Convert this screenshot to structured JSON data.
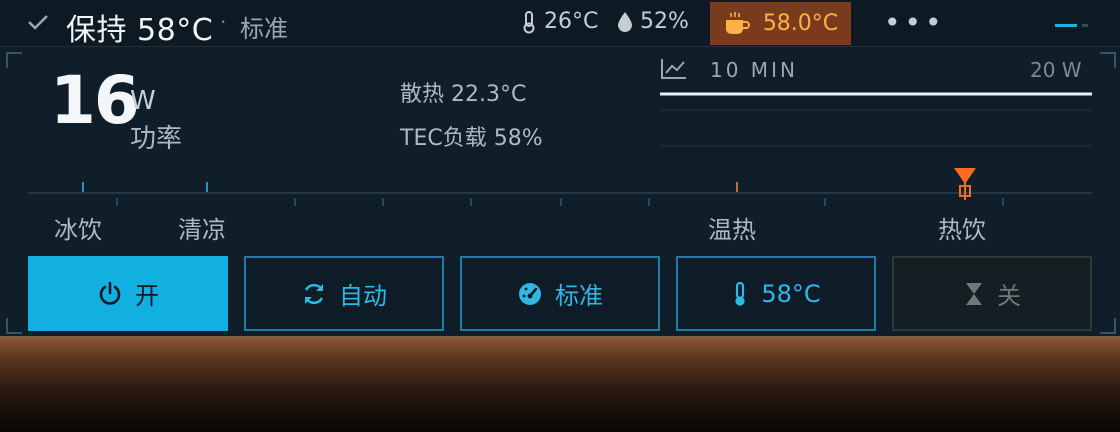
{
  "header": {
    "check_icon": "check-icon",
    "title": "保持 58°C",
    "separator": "·",
    "mode": "标准",
    "temperature": "26°C",
    "temperature_icon": "thermometer-icon",
    "humidity": "52%",
    "humidity_icon": "droplet-icon",
    "drink_temp": "58.0°C",
    "drink_icon": "coffee-cup-icon",
    "more": "•••",
    "accent_color": "#12b0e0",
    "hot_color": "#ffb04a"
  },
  "readout": {
    "power_value": "16",
    "power_unit": "W",
    "power_label": "功率",
    "heat_dissipation": "散热 22.3°C",
    "tec_load": "TEC负载 58%"
  },
  "chart": {
    "icon": "line-chart-icon",
    "title": "10 MIN",
    "max_label": "20 W"
  },
  "slider": {
    "zones": [
      "冰饮",
      "清凉",
      "温热",
      "热饮"
    ],
    "current_marker": "thumb-marker"
  },
  "buttons": {
    "power": {
      "icon": "power-icon",
      "label": "开"
    },
    "auto": {
      "icon": "refresh-icon",
      "label": "自动"
    },
    "mode": {
      "icon": "gauge-icon",
      "label": "标准"
    },
    "target": {
      "icon": "thermometer-icon",
      "label": "58°C"
    },
    "timer": {
      "icon": "hourglass-icon",
      "label": "关"
    }
  }
}
